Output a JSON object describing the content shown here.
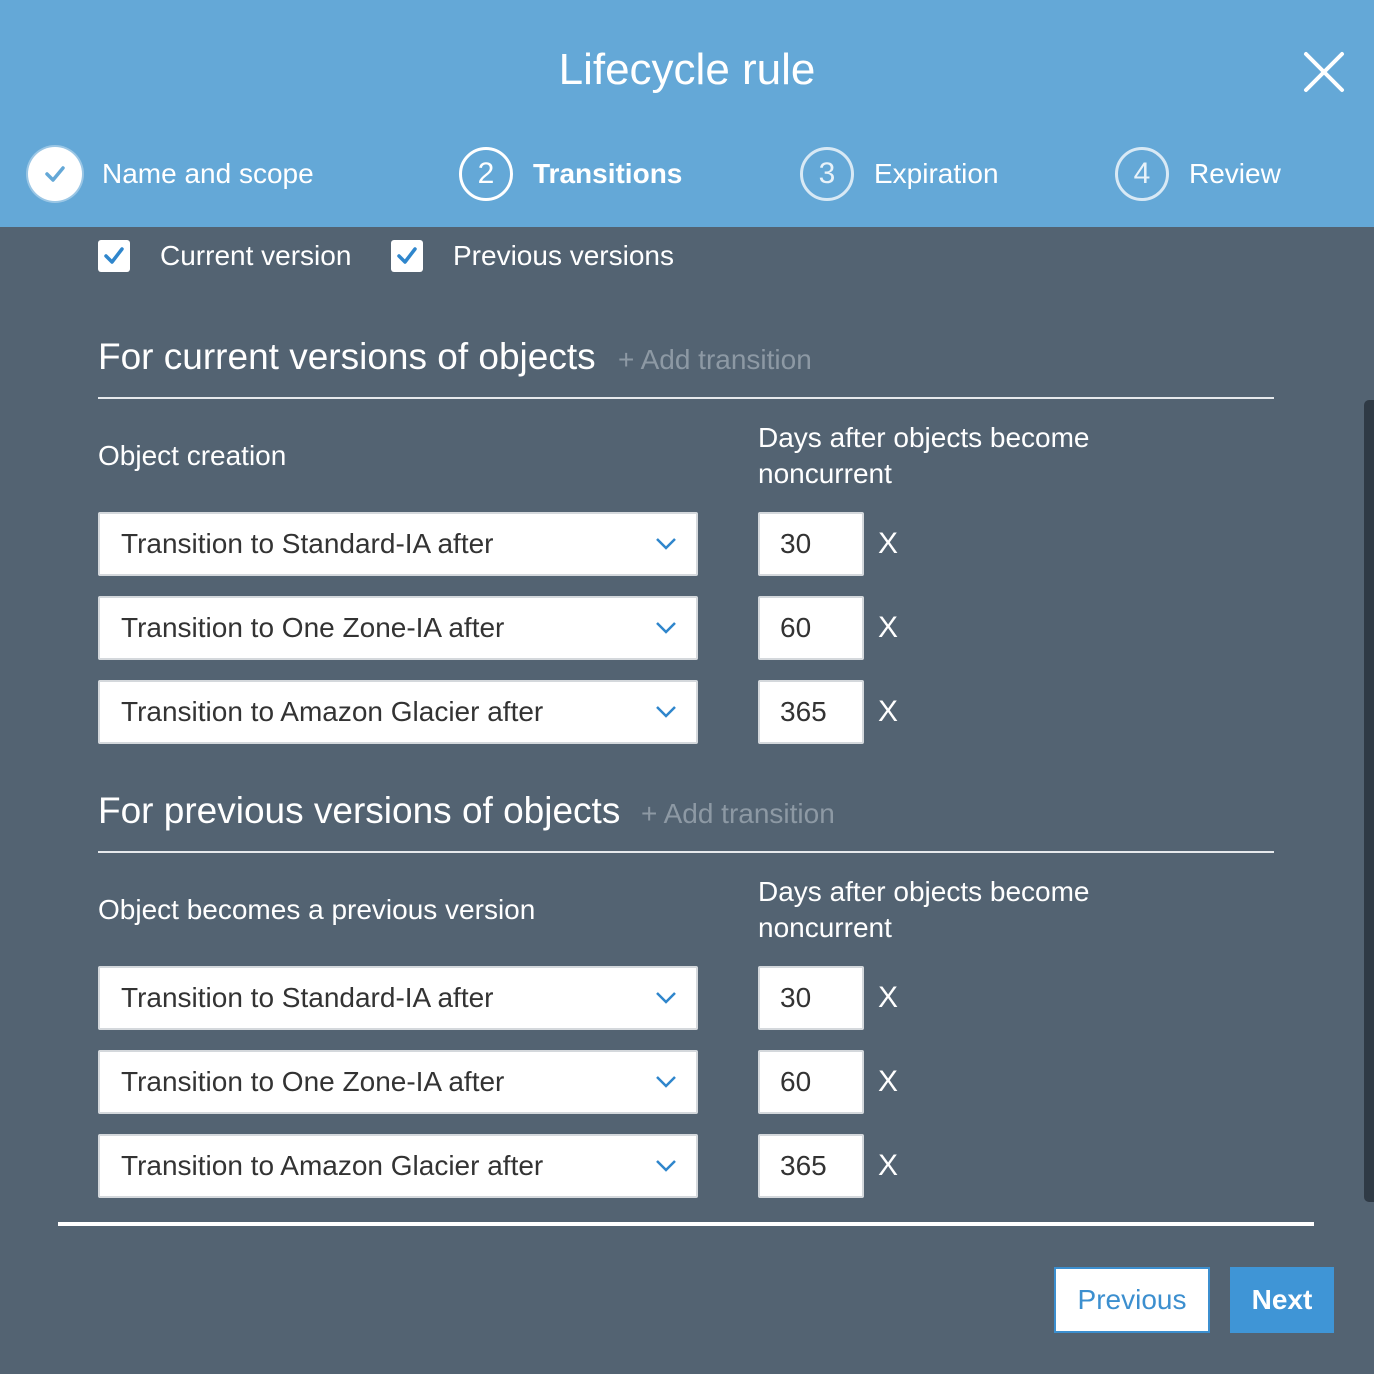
{
  "dialog": {
    "title": "Lifecycle rule",
    "close_icon": "close-icon"
  },
  "steps": [
    {
      "number": "",
      "label": "Name and scope",
      "state": "completed",
      "icon": "check-icon"
    },
    {
      "number": "2",
      "label": "Transitions",
      "state": "active"
    },
    {
      "number": "3",
      "label": "Expiration",
      "state": "pending"
    },
    {
      "number": "4",
      "label": "Review",
      "state": "pending"
    }
  ],
  "versions": {
    "current": {
      "label": "Current version",
      "checked": true
    },
    "previous": {
      "label": "Previous versions",
      "checked": true
    }
  },
  "current_section": {
    "title": "For current versions of objects",
    "add_transition": "+ Add transition",
    "col1": "Object creation",
    "col2": "Days after objects become noncurrent",
    "rows": [
      {
        "storage": "Transition to Standard-IA after",
        "days": "30",
        "remove": "X"
      },
      {
        "storage": "Transition to One Zone-IA after",
        "days": "60",
        "remove": "X"
      },
      {
        "storage": "Transition to Amazon Glacier after",
        "days": "365",
        "remove": "X"
      }
    ]
  },
  "previous_section": {
    "title": "For previous versions of objects",
    "add_transition": "+ Add transition",
    "col1": "Object becomes a previous version",
    "col2": "Days after objects become noncurrent",
    "rows": [
      {
        "storage": "Transition to Standard-IA after",
        "days": "30",
        "remove": "X"
      },
      {
        "storage": "Transition to One Zone-IA after",
        "days": "60",
        "remove": "X"
      },
      {
        "storage": "Transition to Amazon Glacier after",
        "days": "365",
        "remove": "X"
      }
    ]
  },
  "footer": {
    "previous_label": "Previous",
    "next_label": "Next"
  },
  "colors": {
    "header_bg": "#64a8d7",
    "body_bg": "#536372",
    "primary": "#3f95d6"
  }
}
